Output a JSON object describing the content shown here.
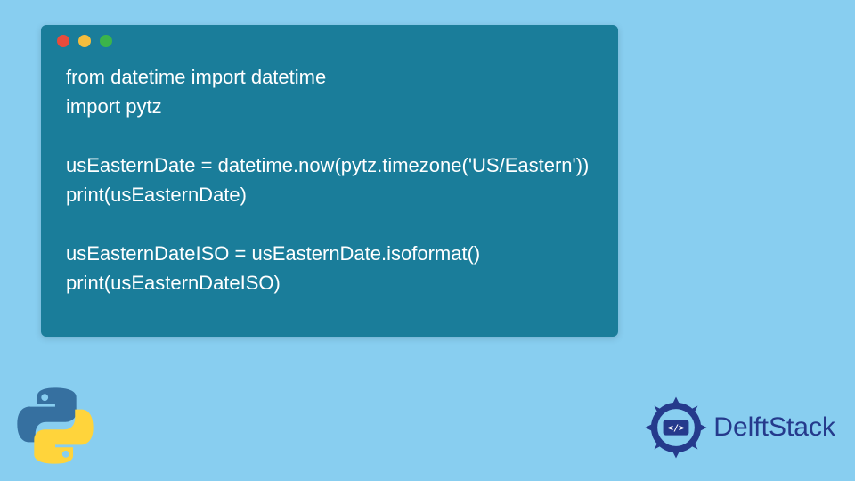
{
  "code": {
    "lines": [
      "from datetime import datetime",
      "import pytz",
      "",
      "usEasternDate = datetime.now(pytz.timezone('US/Eastern'))",
      "print(usEasternDate)",
      "",
      "usEasternDateISO = usEasternDate.isoformat()",
      "print(usEasternDateISO)"
    ]
  },
  "brand": {
    "name": "DelftStack"
  },
  "colors": {
    "page_bg": "#88cef0",
    "window_bg": "#1a7d9a",
    "code_text": "#ffffff",
    "brand_text": "#253a8c",
    "dot_red": "#e94b3c",
    "dot_yellow": "#f5bd3d",
    "dot_green": "#3bb44a"
  },
  "icons": {
    "python": "python-logo-icon",
    "delft": "delft-gear-icon"
  }
}
